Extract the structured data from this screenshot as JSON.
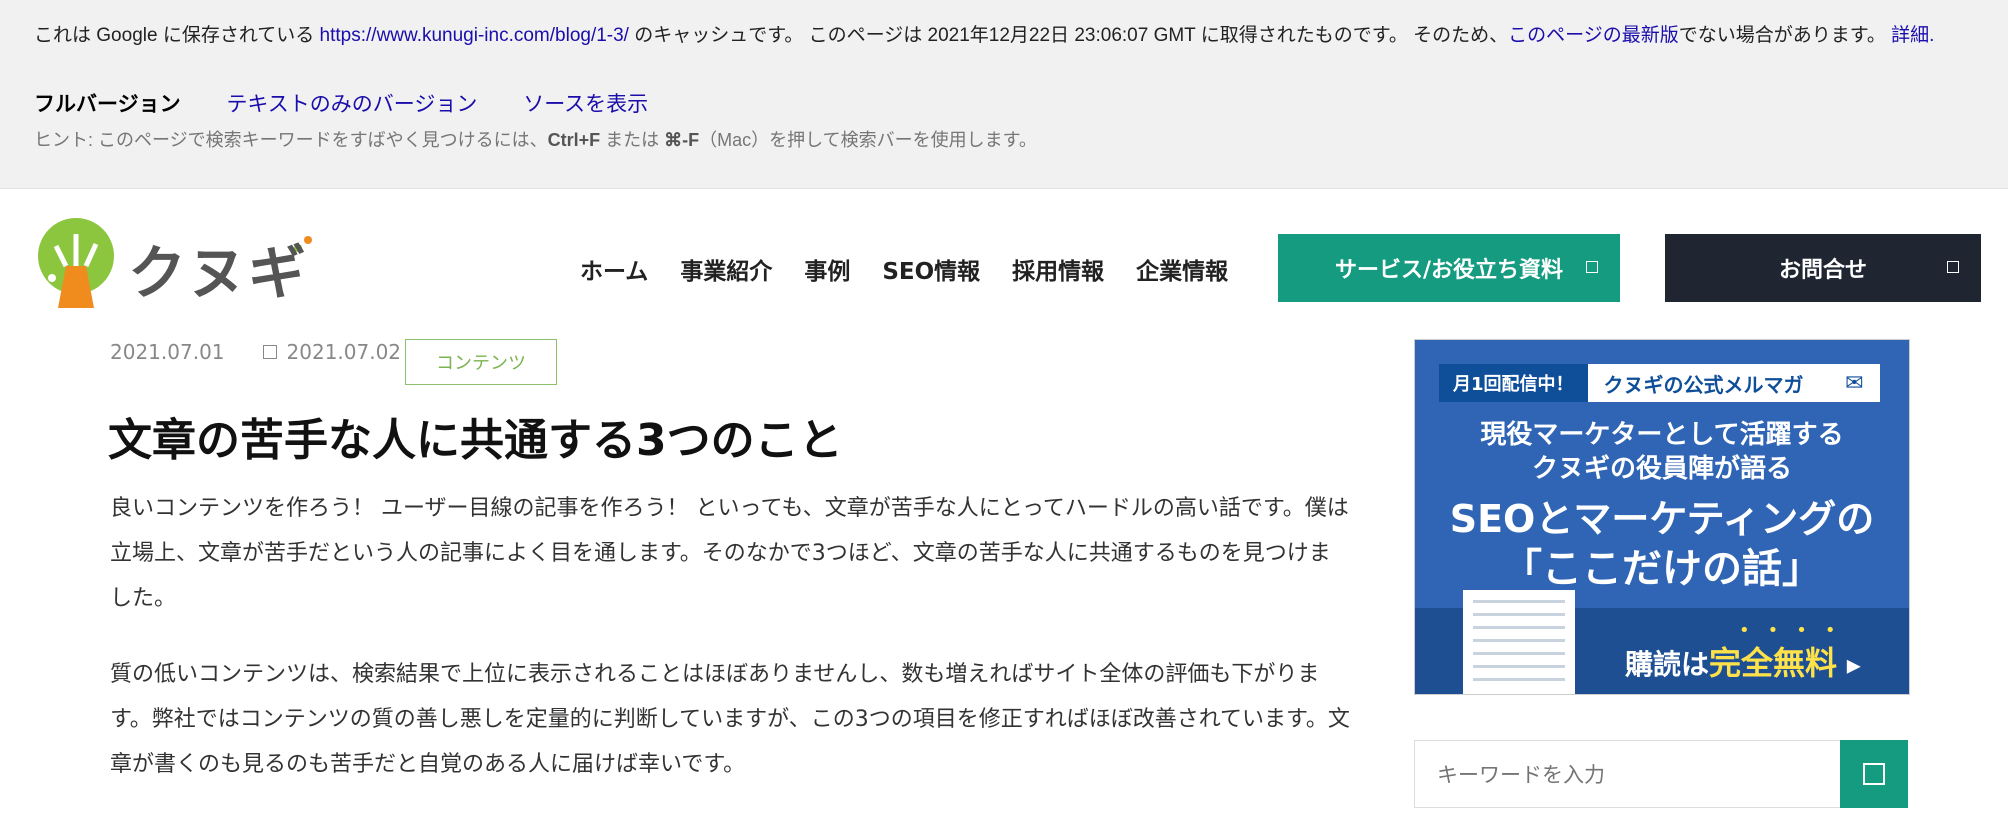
{
  "cache": {
    "intro": "これは Google に保存されている ",
    "url": "https://www.kunugi-inc.com/blog/1-3/",
    "after_url": " のキャッシュです。 このページは 2021年12月22日 23:06:07 GMT に取得されたものです。 そのため、",
    "latest_link": "このページの最新版",
    "after_latest": "でない場合があります。 ",
    "details_link": "詳細.",
    "version_full": "フルバージョン",
    "version_text": "テキストのみのバージョン",
    "version_source": "ソースを表示",
    "hint_prefix": "ヒント: このページで検索キーワードをすばやく見つけるには、",
    "hint_key1": "Ctrl+F",
    "hint_mid": " または ",
    "hint_key2": "⌘-F",
    "hint_suffix": "（Mac）を押して検索バーを使用します。"
  },
  "header": {
    "logo_text": "クヌギ",
    "nav": [
      "ホーム",
      "事業紹介",
      "事例",
      "SEO情報",
      "採用情報",
      "企業情報"
    ],
    "service_button": "サービス/お役立ち資料",
    "contact_button": "お問合せ"
  },
  "article": {
    "published": "2021.07.01",
    "updated": "2021.07.02",
    "category": "コンテンツ",
    "title": "文章の苦手な人に共通する3つのこと",
    "paragraph1": "良いコンテンツを作ろう！ ユーザー目線の記事を作ろう！ といっても、文章が苦手な人にとってハードルの高い話です。僕は立場上、文章が苦手だという人の記事によく目を通します。そのなかで3つほど、文章の苦手な人に共通するものを見つけました。",
    "paragraph2": "質の低いコンテンツは、検索結果で上位に表示されることはほぼありませんし、数も増えればサイト全体の評価も下がります。弊社ではコンテンツの質の善し悪しを定量的に判断していますが、この3つの項目を修正すればほぼ改善されています。文章が書くのも見るのも苦手だと自覚のある人に届けば幸いです。"
  },
  "sidebar": {
    "banner_tag": "月1回配信中！",
    "banner_magazine": "クヌギの公式メルマガ",
    "banner_line1": "現役マーケターとして活躍する",
    "banner_line2": "クヌギの役員陣が語る",
    "banner_line3": "SEOとマーケティングの",
    "banner_line4": "「ここだけの話」",
    "banner_sub": "購読は",
    "banner_free": "完全無料",
    "search_placeholder": "キーワードを入力"
  },
  "colors": {
    "accent_green": "#159b7f",
    "dark_button": "#1f2631",
    "link_blue": "#1a0dab",
    "banner_blue": "#2f65b4"
  }
}
